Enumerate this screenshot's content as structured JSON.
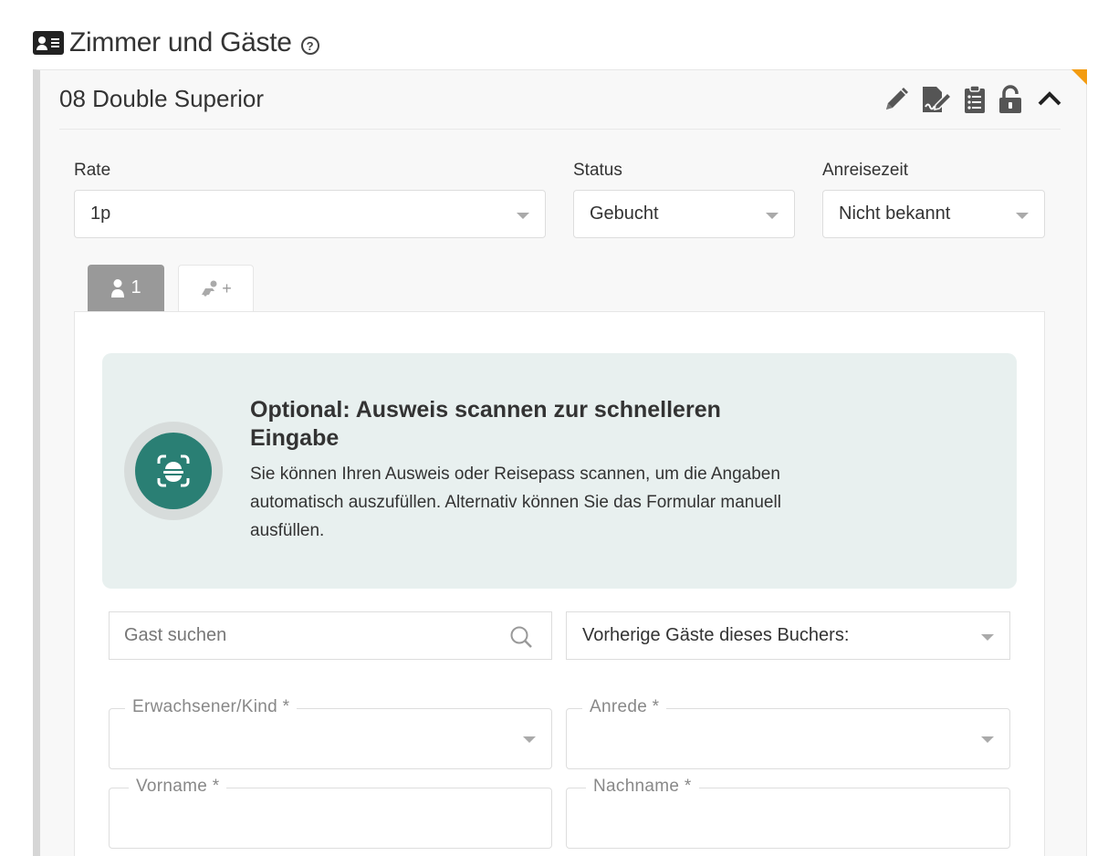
{
  "section": {
    "title": "Zimmer und Gäste",
    "help": "?"
  },
  "room": {
    "name": "08 Double Superior"
  },
  "fields": {
    "rate": {
      "label": "Rate",
      "value": "1p"
    },
    "status": {
      "label": "Status",
      "value": "Gebucht"
    },
    "arrival": {
      "label": "Anreisezeit",
      "value": "Nicht bekannt"
    }
  },
  "tabs": {
    "guest_count": "1",
    "add_symbol": "+"
  },
  "scan": {
    "title": "Optional: Ausweis scannen zur schnelleren Eingabe",
    "description": "Sie können Ihren Ausweis oder Reisepass scannen, um die Angaben automatisch auszufüllen. Alternativ können Sie das Formular manuell ausfüllen."
  },
  "guest_search": {
    "placeholder": "Gast suchen"
  },
  "previous_guests": {
    "value": "Vorherige Gäste dieses Buchers:"
  },
  "form": {
    "adult_child_label": "Erwachsener/Kind *",
    "salutation_label": "Anrede *",
    "firstname_label": "Vorname *",
    "lastname_label": "Nachname *"
  },
  "colors": {
    "accent": "#2a7f74",
    "corner_flag": "#f39c12",
    "tab_active": "#999999",
    "scan_bg": "#e8f0ef"
  }
}
